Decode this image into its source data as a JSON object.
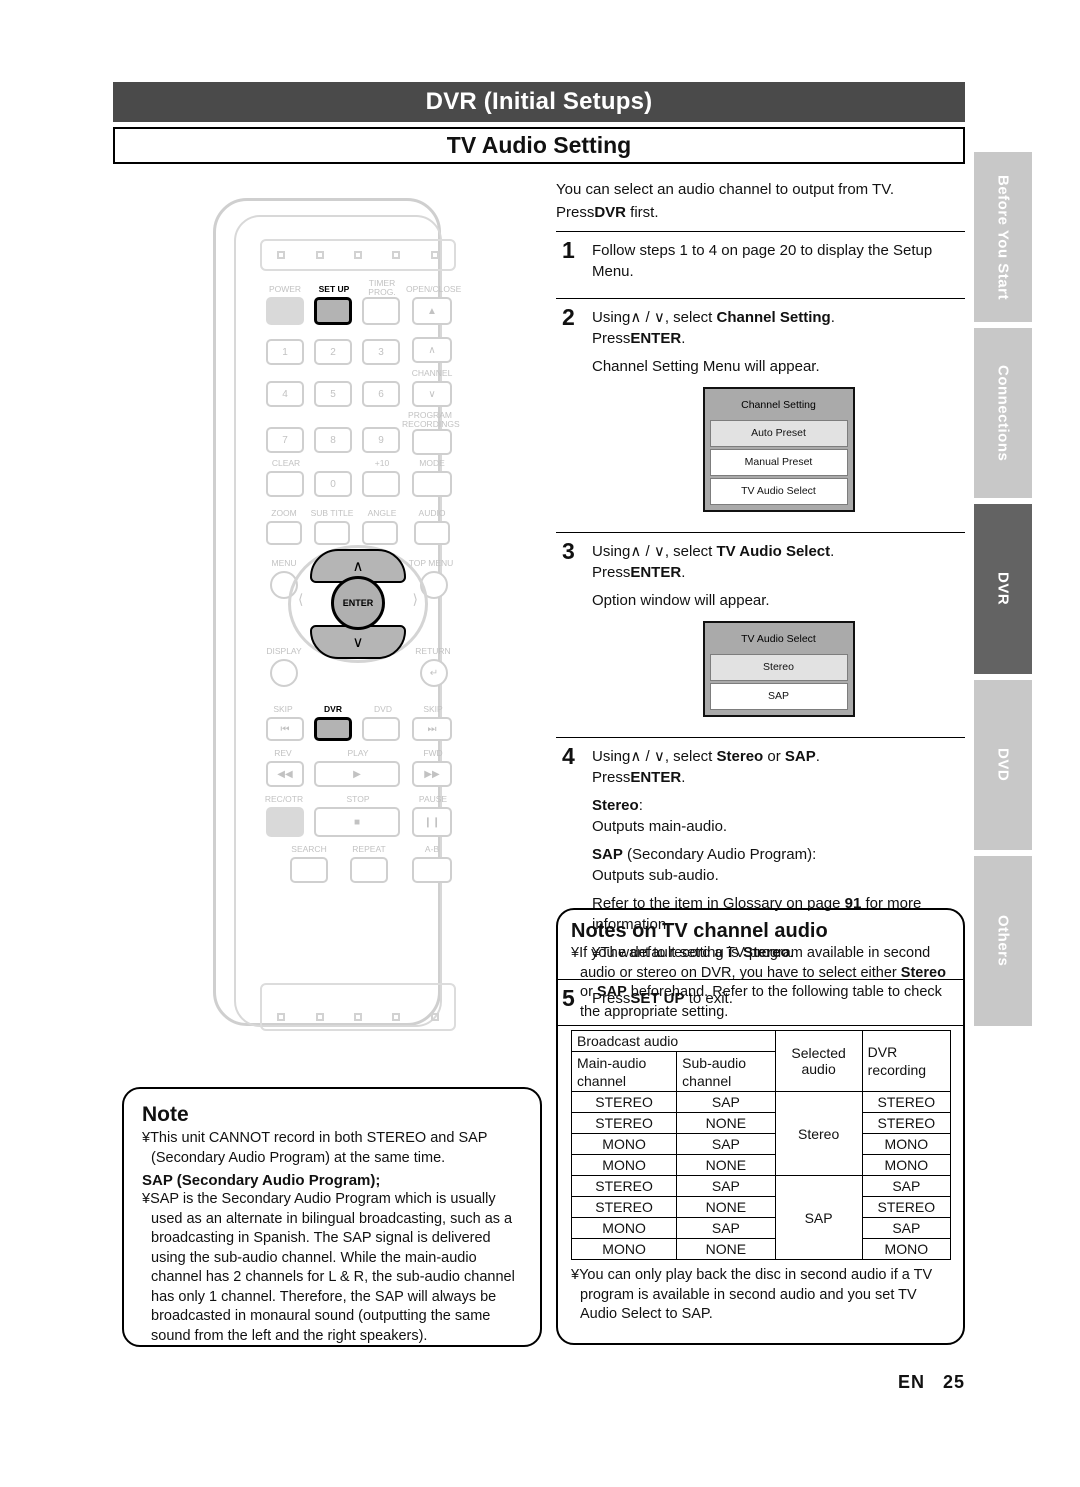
{
  "header": {
    "title": "DVR (Initial Setups)",
    "subtitle": "TV Audio Setting"
  },
  "side_tabs": [
    {
      "label": "Before You Start",
      "active": false
    },
    {
      "label": "Connections",
      "active": false
    },
    {
      "label": "DVR",
      "active": true
    },
    {
      "label": "DVD",
      "active": false
    },
    {
      "label": "Others",
      "active": false
    }
  ],
  "intro": {
    "line1": "You can select an audio channel to output from TV.",
    "line2_pre": "Press",
    "line2_bold": "DVR",
    "line2_post": " first."
  },
  "steps": {
    "s1": {
      "num": "1",
      "text": "Follow steps 1 to 4 on page 20 to display the Setup Menu."
    },
    "s2": {
      "num": "2",
      "l1_pre": "Using",
      "l1_arrows": "∧ / ∨",
      "l1_mid": ", select ",
      "l1_bold": "Channel Setting",
      "l1_post": ".",
      "l2_pre": "Press",
      "l2_bold": "ENTER",
      "l2_post": ".",
      "l3": "Channel Setting Menu will appear.",
      "osd": {
        "title": "Channel Setting",
        "items": [
          "Auto Preset",
          "Manual Preset",
          "TV Audio Select"
        ],
        "selected_index": 0
      }
    },
    "s3": {
      "num": "3",
      "l1_pre": "Using",
      "l1_arrows": "∧ / ∨",
      "l1_mid": ", select ",
      "l1_bold": "TV Audio Select",
      "l1_post": ".",
      "l2_pre": "Press",
      "l2_bold": "ENTER",
      "l2_post": ".",
      "l3": "Option window will appear.",
      "osd": {
        "title": "TV Audio Select",
        "items": [
          "Stereo",
          "SAP"
        ],
        "selected_index": 0
      }
    },
    "s4": {
      "num": "4",
      "l1_pre": "Using",
      "l1_arrows": "∧ / ∨",
      "l1_mid": ", select ",
      "l1_bold1": "Stereo",
      "l1_or": " or ",
      "l1_bold2": "SAP",
      "l1_post": ".",
      "l2_pre": "Press",
      "l2_bold": "ENTER",
      "l2_post": ".",
      "stereo_label": "Stereo",
      "stereo_colon": ":",
      "stereo_desc": "Outputs main-audio.",
      "sap_label": "SAP",
      "sap_paren": " (Secondary Audio Program):",
      "sap_desc": "Outputs sub-audio.",
      "refer_pre": "Refer to the item in ",
      "refer_italic": "Glossary",
      "refer_mid": " on page ",
      "refer_page": "91",
      "refer_post": " for more information.",
      "default_bullet": "¥",
      "default_pre": "The default setting is ",
      "default_bold": "Stereo",
      "default_post": "."
    },
    "s5": {
      "num": "5",
      "l1_pre": "Press",
      "l1_bold": "SET UP",
      "l1_post": " to exit."
    }
  },
  "notes_right": {
    "title": "Notes on TV channel audio",
    "bullet1_mark": "¥",
    "bullet1_a": "If you want to record a TV program available in second audio or stereo on DVR, you have to select either ",
    "bullet1_b1": "Stereo",
    "bullet1_or": " or ",
    "bullet1_b2": "SAP",
    "bullet1_c": " beforehand. Refer to the following table to check the appropriate setting.",
    "bullet2_mark": "¥",
    "bullet2": "You can only play back the disc in second audio if a TV program is available in second audio and you set TV Audio Select to SAP."
  },
  "table": {
    "group_header": "Broadcast audio",
    "col_selected": "Selected audio",
    "col_dvr": "DVR recording",
    "col_main": "Main-audio channel",
    "col_sub": "Sub-audio channel",
    "groups": [
      {
        "selected": "Stereo",
        "rows": [
          {
            "main": "STEREO",
            "sub": "SAP",
            "dvr": "STEREO"
          },
          {
            "main": "STEREO",
            "sub": "NONE",
            "dvr": "STEREO"
          },
          {
            "main": "MONO",
            "sub": "SAP",
            "dvr": "MONO"
          },
          {
            "main": "MONO",
            "sub": "NONE",
            "dvr": "MONO"
          }
        ]
      },
      {
        "selected": "SAP",
        "rows": [
          {
            "main": "STEREO",
            "sub": "SAP",
            "dvr": "SAP"
          },
          {
            "main": "STEREO",
            "sub": "NONE",
            "dvr": "STEREO"
          },
          {
            "main": "MONO",
            "sub": "SAP",
            "dvr": "SAP"
          },
          {
            "main": "MONO",
            "sub": "NONE",
            "dvr": "MONO"
          }
        ]
      }
    ]
  },
  "note_left": {
    "title": "Note",
    "b1_mark": "¥",
    "b1": "This unit CANNOT record in both STEREO and SAP (Secondary Audio Program) at the same time.",
    "subtitle": "SAP (Secondary Audio Program);",
    "b2_mark": "¥",
    "b2": "SAP is the Secondary Audio Program which is usually used as an alternate in bilingual broadcasting, such as a broadcasting in Spanish. The SAP signal is delivered using the sub-audio channel. While the main-audio channel has 2 channels for L & R, the sub-audio channel has only 1 channel. Therefore, the SAP will always be broadcasted in monaural sound (outputting the same sound from the left and the right speakers)."
  },
  "remote": {
    "labels": {
      "power": "POWER",
      "setup": "SET UP",
      "timer": "TIMER\nPROG.",
      "openclose": "OPEN/CLOSE",
      "channel": "CHANNEL",
      "program_rec": "PROGRAM\nRECORDINGS",
      "clear": "CLEAR",
      "plus10": "+10",
      "mode": "MODE",
      "zoom": "ZOOM",
      "subtitle": "SUB TITLE",
      "angle": "ANGLE",
      "audio": "AUDIO",
      "menu": "MENU",
      "topmenu": "TOP MENU",
      "display": "DISPLAY",
      "return": "RETURN",
      "enter": "ENTER",
      "skip_back": "SKIP",
      "dvr": "DVR",
      "dvd": "DVD",
      "skip_fwd": "SKIP",
      "rev": "REV",
      "play": "PLAY",
      "fwd": "FWD",
      "recotr": "REC/OTR",
      "stop": "STOP",
      "pause": "PAUSE",
      "search": "SEARCH",
      "repeat": "REPEAT",
      "ab": "A-B",
      "n1": "1",
      "n2": "2",
      "n3": "3",
      "n4": "4",
      "n5": "5",
      "n6": "6",
      "n7": "7",
      "n8": "8",
      "n9": "9",
      "n0": "0"
    }
  },
  "footer": {
    "lang": "EN",
    "page": "25"
  }
}
